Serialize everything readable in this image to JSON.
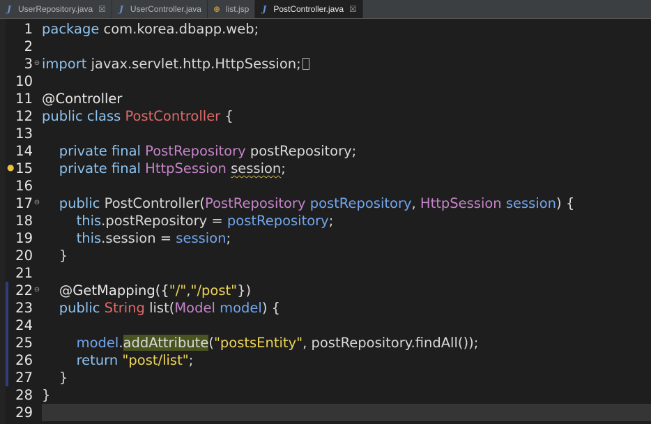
{
  "tabs": [
    {
      "label": "UserRepository.java",
      "icon": "java-file-icon",
      "active": false,
      "closable": true
    },
    {
      "label": "UserController.java",
      "icon": "java-file-icon",
      "active": false,
      "closable": false
    },
    {
      "label": "list.jsp",
      "icon": "jsp-file-icon",
      "active": false,
      "closable": false
    },
    {
      "label": "PostController.java",
      "icon": "java-file-icon",
      "active": true,
      "closable": true
    }
  ],
  "icons": {
    "java": "J",
    "jsp": "⊕",
    "close": "☒",
    "fold": "⊖",
    "bulb": "💡"
  },
  "colors": {
    "keyword": "#8ec3f0",
    "class_decl": "#e06a6a",
    "type": "#c584c8",
    "field": "#72a6ef",
    "string": "#eed655",
    "plain": "#d8d8d8",
    "occurrence_highlight": "#4a5420",
    "current_line": "#353535"
  },
  "editor": {
    "current_line": 29,
    "lines": [
      {
        "n": "1",
        "parts": [
          {
            "t": "package",
            "c": "kw"
          },
          {
            "t": " com.korea.dbapp.web;",
            "c": "pl"
          }
        ]
      },
      {
        "n": "2",
        "parts": []
      },
      {
        "n": "3",
        "fold": true,
        "parts": [
          {
            "t": "import",
            "c": "kw"
          },
          {
            "t": " javax.servlet.http.HttpSession;",
            "c": "pl"
          }
        ],
        "folded": true
      },
      {
        "n": "10",
        "parts": []
      },
      {
        "n": "11",
        "parts": [
          {
            "t": "@Controller",
            "c": "ann"
          }
        ]
      },
      {
        "n": "12",
        "parts": [
          {
            "t": "public class ",
            "c": "kw"
          },
          {
            "t": "PostController",
            "c": "cls"
          },
          {
            "t": " {",
            "c": "pl"
          }
        ]
      },
      {
        "n": "13",
        "parts": []
      },
      {
        "n": "14",
        "parts": [
          {
            "t": "    private final ",
            "c": "kw"
          },
          {
            "t": "PostRepository",
            "c": "typ"
          },
          {
            "t": " postRepository;",
            "c": "pl"
          }
        ]
      },
      {
        "n": "15",
        "bulb": true,
        "parts": [
          {
            "t": "    private final ",
            "c": "kw"
          },
          {
            "t": "HttpSession",
            "c": "typ"
          },
          {
            "t": " ",
            "c": "pl"
          },
          {
            "t": "session",
            "c": "pl warn"
          },
          {
            "t": ";",
            "c": "pl"
          }
        ]
      },
      {
        "n": "16",
        "parts": []
      },
      {
        "n": "17",
        "fold": true,
        "parts": [
          {
            "t": "    public ",
            "c": "kw"
          },
          {
            "t": "PostController(",
            "c": "pl"
          },
          {
            "t": "PostRepository",
            "c": "typ"
          },
          {
            "t": " postRepository",
            "c": "fld"
          },
          {
            "t": ", ",
            "c": "pl"
          },
          {
            "t": "HttpSession",
            "c": "typ"
          },
          {
            "t": " session",
            "c": "fld"
          },
          {
            "t": ") {",
            "c": "pl"
          }
        ]
      },
      {
        "n": "18",
        "parts": [
          {
            "t": "        this",
            "c": "kw"
          },
          {
            "t": ".postRepository = ",
            "c": "pl"
          },
          {
            "t": "postRepository",
            "c": "fld"
          },
          {
            "t": ";",
            "c": "pl"
          }
        ]
      },
      {
        "n": "19",
        "parts": [
          {
            "t": "        this",
            "c": "kw"
          },
          {
            "t": ".session = ",
            "c": "pl"
          },
          {
            "t": "session",
            "c": "fld"
          },
          {
            "t": ";",
            "c": "pl"
          }
        ]
      },
      {
        "n": "20",
        "parts": [
          {
            "t": "    }",
            "c": "pl"
          }
        ]
      },
      {
        "n": "21",
        "parts": []
      },
      {
        "n": "22",
        "fold": true,
        "range": true,
        "parts": [
          {
            "t": "    @GetMapping({",
            "c": "ann"
          },
          {
            "t": "\"/\"",
            "c": "str"
          },
          {
            "t": ",",
            "c": "pl"
          },
          {
            "t": "\"/post\"",
            "c": "str"
          },
          {
            "t": "})",
            "c": "pl"
          }
        ]
      },
      {
        "n": "23",
        "range": true,
        "parts": [
          {
            "t": "    public ",
            "c": "kw"
          },
          {
            "t": "String",
            "c": "cls"
          },
          {
            "t": " list(",
            "c": "pl"
          },
          {
            "t": "Model",
            "c": "typ"
          },
          {
            "t": " model",
            "c": "fld"
          },
          {
            "t": ") {",
            "c": "pl"
          }
        ]
      },
      {
        "n": "24",
        "range": true,
        "parts": []
      },
      {
        "n": "25",
        "range": true,
        "parts": [
          {
            "t": "        model",
            "c": "fld"
          },
          {
            "t": ".",
            "c": "pl"
          },
          {
            "t": "addAttribute",
            "c": "pl hl"
          },
          {
            "t": "(",
            "c": "pl"
          },
          {
            "t": "\"postsEntity\"",
            "c": "str"
          },
          {
            "t": ", postRepository.findAll());",
            "c": "pl"
          }
        ]
      },
      {
        "n": "26",
        "range": true,
        "parts": [
          {
            "t": "        return ",
            "c": "kw"
          },
          {
            "t": "\"post/list\"",
            "c": "str"
          },
          {
            "t": ";",
            "c": "pl"
          }
        ]
      },
      {
        "n": "27",
        "range": true,
        "parts": [
          {
            "t": "    }",
            "c": "pl"
          }
        ]
      },
      {
        "n": "28",
        "parts": [
          {
            "t": "}",
            "c": "pl"
          }
        ]
      },
      {
        "n": "29",
        "parts": []
      }
    ]
  }
}
